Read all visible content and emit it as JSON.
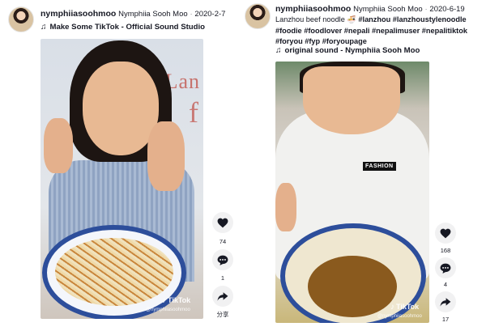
{
  "posts": [
    {
      "username": "nymphiiasoohmoo",
      "display_name": "Nymphiia Sooh Moo",
      "separator": "·",
      "date": "2020-2-7",
      "caption_text": "",
      "music": "Make Some TikTok - Official Sound Studio",
      "wall_text_1": "Lan",
      "wall_text_2": "f",
      "watermark_brand": "TikTok",
      "watermark_user": "@nymphiiasoohmoo",
      "likes": "74",
      "comments": "1",
      "shares": "分享"
    },
    {
      "username": "nymphiiasoohmoo",
      "display_name": "Nymphiia Sooh Moo",
      "separator": "·",
      "date": "2020-6-19",
      "caption_text": "Lanzhou beef noodle",
      "caption_emoji": "🍜",
      "hashtags": [
        "#lanzhou",
        "#lanzhoustylenoodle",
        "#foodie",
        "#foodlover",
        "#nepali",
        "#nepalimuser",
        "#nepalitiktok",
        "#foryou",
        "#fyp",
        "#foryoupage"
      ],
      "music": "original sound - Nymphiia Sooh Moo",
      "hoodie_text": "FASHION",
      "watermark_brand": "TikTok",
      "watermark_user": "@nymphiiasoohmoo",
      "likes": "168",
      "comments": "4",
      "shares": "17"
    }
  ],
  "icons": {
    "music": "♫",
    "like": "heart-icon",
    "comment": "comment-icon",
    "share": "share-icon"
  },
  "colors": {
    "text": "#161823",
    "muted": "#8a8b91",
    "button_bg": "#f1f1f2"
  }
}
